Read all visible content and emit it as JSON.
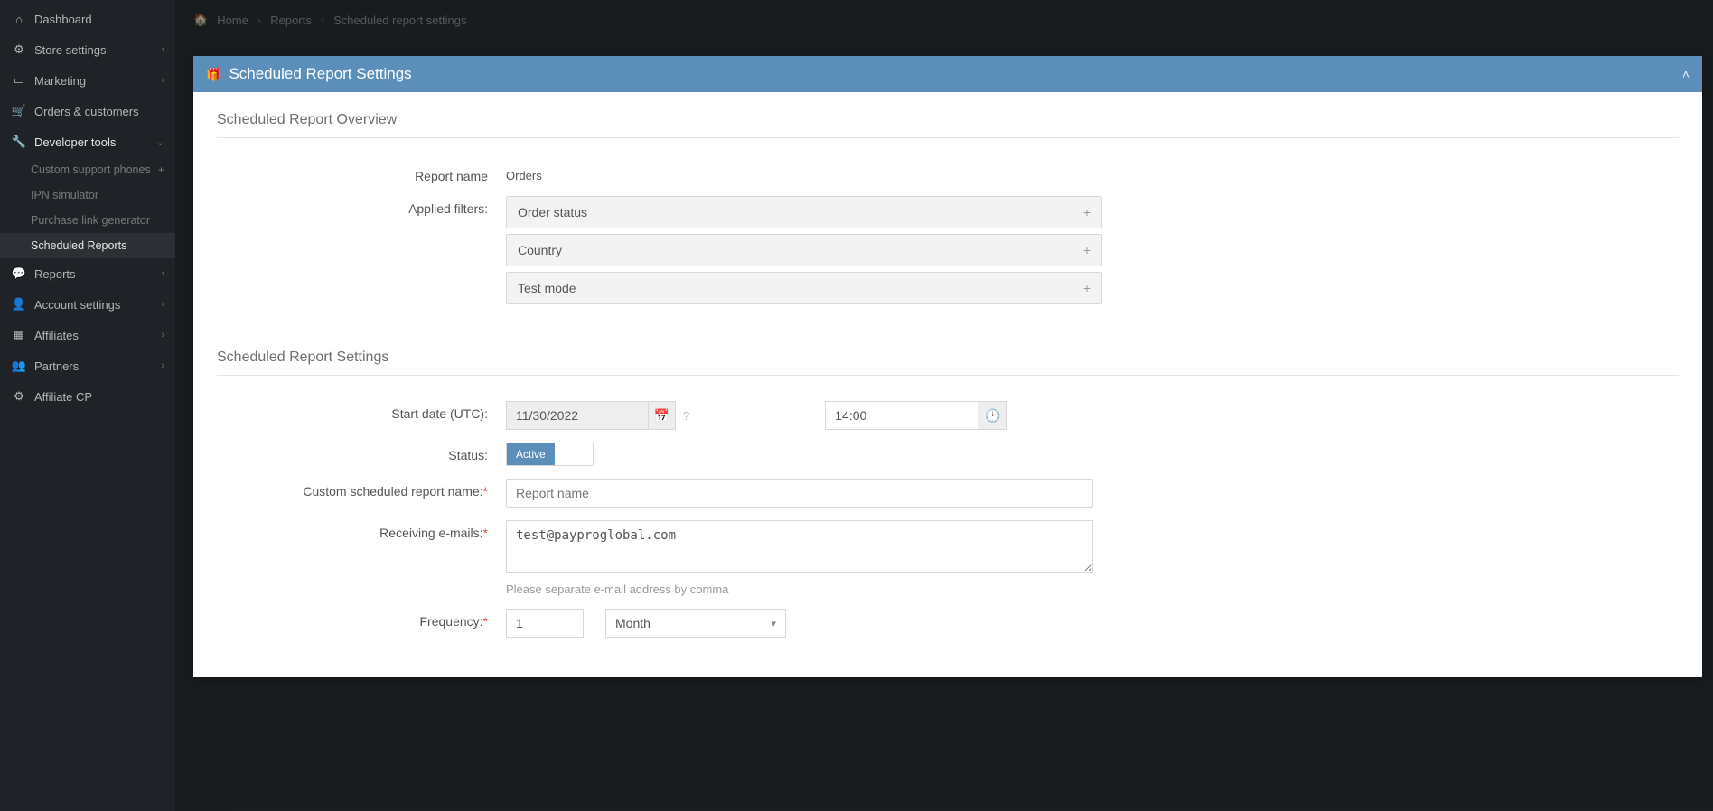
{
  "sidebar": {
    "items": [
      {
        "label": "Dashboard",
        "icon": "home-outline-icon"
      },
      {
        "label": "Store settings",
        "icon": "gear-icon",
        "chev": true
      },
      {
        "label": "Marketing",
        "icon": "card-icon",
        "chev": true
      },
      {
        "label": "Orders & customers",
        "icon": "cart-icon"
      },
      {
        "label": "Developer tools",
        "icon": "wrench-icon",
        "expanded": true
      },
      {
        "label": "Reports",
        "icon": "chat-icon",
        "chev": true
      },
      {
        "label": "Account settings",
        "icon": "user-icon",
        "chev": true
      },
      {
        "label": "Affiliates",
        "icon": "grid-icon",
        "chev": true
      },
      {
        "label": "Partners",
        "icon": "people-icon",
        "chev": true
      },
      {
        "label": "Affiliate CP",
        "icon": "gear-icon"
      }
    ],
    "dev_sub": [
      {
        "label": "Custom support phones",
        "plus": true
      },
      {
        "label": "IPN simulator"
      },
      {
        "label": "Purchase link generator"
      },
      {
        "label": "Scheduled Reports",
        "active": true
      }
    ]
  },
  "breadcrumb": {
    "home": "Home",
    "reports": "Reports",
    "current": "Scheduled report settings"
  },
  "panel": {
    "title": "Scheduled Report Settings"
  },
  "overview": {
    "section_title": "Scheduled Report Overview",
    "report_name_label": "Report name",
    "report_name_value": "Orders",
    "applied_filters_label": "Applied filters:",
    "filters": [
      {
        "label": "Order status"
      },
      {
        "label": "Country"
      },
      {
        "label": "Test mode"
      }
    ]
  },
  "settings": {
    "section_title": "Scheduled Report Settings",
    "start_date_label": "Start date (UTC):",
    "start_date_value": "11/30/2022",
    "start_time_value": "14:00",
    "status_label": "Status:",
    "status_active": "Active",
    "custom_name_label": "Custom scheduled report name:",
    "custom_name_placeholder": "Report name",
    "emails_label": "Receiving e-mails:",
    "emails_value": "test@payproglobal.com",
    "emails_helper": "Please separate e-mail address by comma",
    "frequency_label": "Frequency:",
    "frequency_value": "1",
    "frequency_unit": "Month"
  }
}
